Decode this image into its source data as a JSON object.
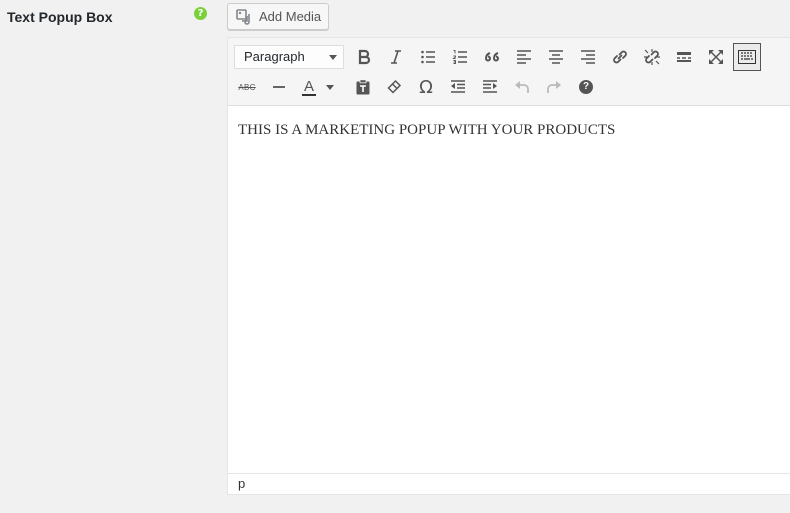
{
  "field": {
    "label": "Text Popup Box",
    "help_glyph": "?"
  },
  "add_media": {
    "label": "Add Media",
    "icon": "media-icon"
  },
  "toolbar": {
    "format_select": "Paragraph",
    "row1_icons": [
      "bold-icon",
      "italic-icon",
      "bullet-list-icon",
      "numbered-list-icon",
      "blockquote-icon",
      "align-left-icon",
      "align-center-icon",
      "align-right-icon",
      "link-icon",
      "unlink-icon",
      "read-more-icon",
      "fullscreen-icon",
      "toolbar-toggle-icon"
    ],
    "row2_icons": [
      "strikethrough-icon",
      "horizontal-line-icon",
      "text-color-icon",
      "paste-text-icon",
      "clear-formatting-icon",
      "special-character-icon",
      "outdent-icon",
      "indent-icon",
      "undo-icon",
      "redo-icon",
      "keyboard-shortcuts-icon"
    ],
    "strikethrough_glyph": "ABC",
    "text_color_glyph": "A",
    "omega_glyph": "Ω",
    "help_glyph": "?"
  },
  "editor": {
    "content": "THIS IS A MARKETING POPUP WITH YOUR PRODUCTS",
    "path": "p"
  },
  "colors": {
    "accent_green": "#7ad03a",
    "toolbar_bg": "#f5f5f5",
    "page_bg": "#f1f1f1"
  }
}
